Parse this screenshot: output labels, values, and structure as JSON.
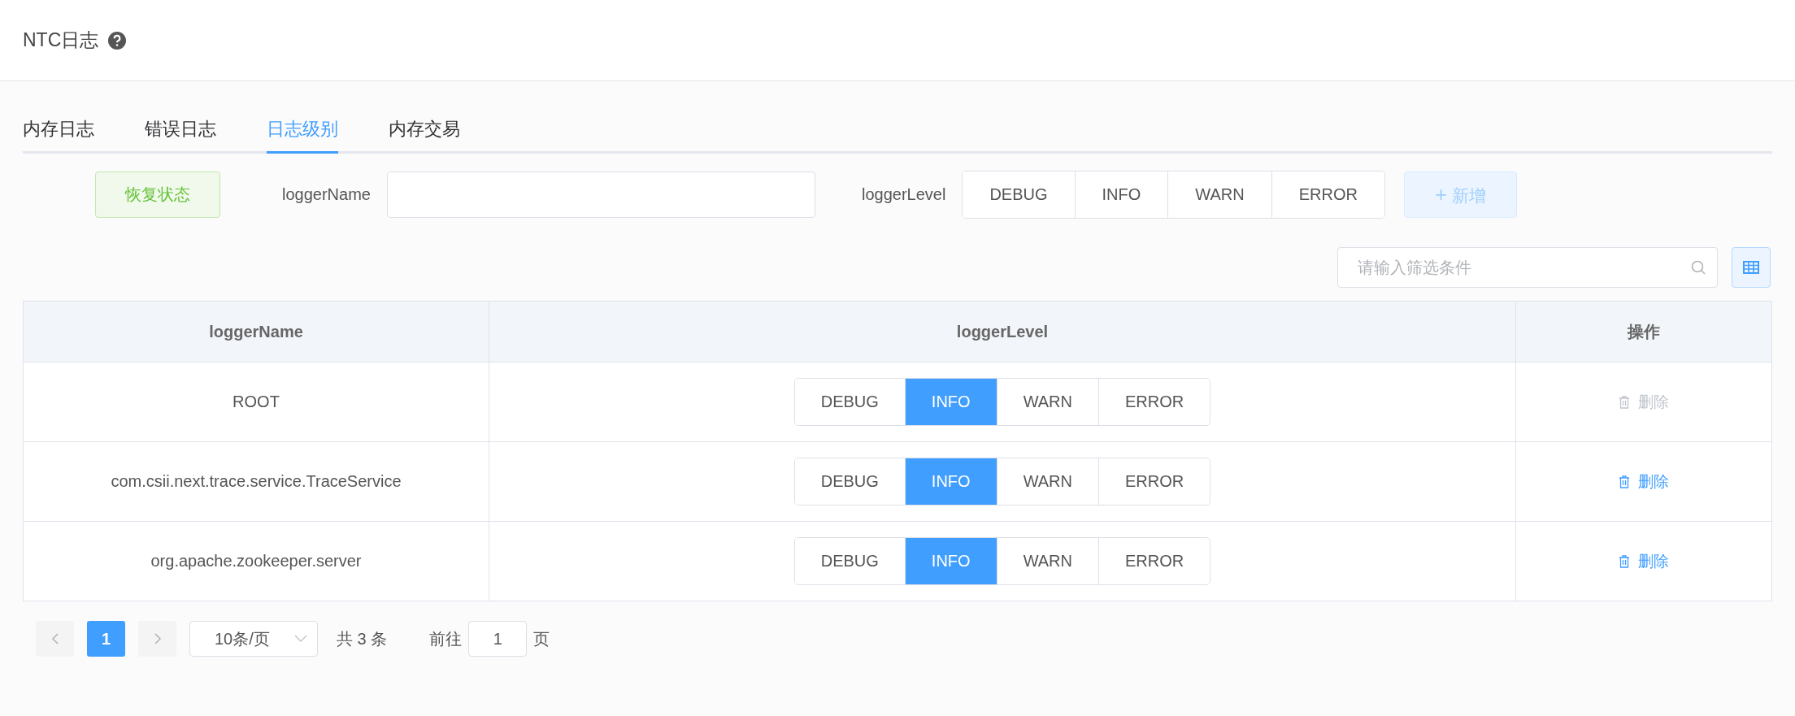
{
  "page": {
    "title": "NTC日志"
  },
  "tabs": [
    {
      "label": "内存日志",
      "selected": false
    },
    {
      "label": "错误日志",
      "selected": false
    },
    {
      "label": "日志级别",
      "selected": true
    },
    {
      "label": "内存交易",
      "selected": false
    }
  ],
  "form": {
    "restore_button": "恢复状态",
    "name_label": "loggerName",
    "level_label": "loggerLevel",
    "levels": [
      {
        "label": "DEBUG",
        "selected": false
      },
      {
        "label": "INFO",
        "selected": false
      },
      {
        "label": "WARN",
        "selected": false
      },
      {
        "label": "ERROR",
        "selected": false
      }
    ],
    "add_button": {
      "icon": "+",
      "label": "新增",
      "disabled": true
    }
  },
  "search": {
    "placeholder": "请输入筛选条件"
  },
  "table": {
    "columns": [
      "loggerName",
      "loggerLevel",
      "操作"
    ],
    "rows": [
      {
        "name": "ROOT",
        "levels": [
          {
            "label": "DEBUG",
            "selected": false
          },
          {
            "label": "INFO",
            "selected": true
          },
          {
            "label": "WARN",
            "selected": false
          },
          {
            "label": "ERROR",
            "selected": false
          }
        ],
        "action": {
          "label": "删除",
          "disabled": true
        }
      },
      {
        "name": "com.csii.next.trace.service.TraceService",
        "levels": [
          {
            "label": "DEBUG",
            "selected": false
          },
          {
            "label": "INFO",
            "selected": true
          },
          {
            "label": "WARN",
            "selected": false
          },
          {
            "label": "ERROR",
            "selected": false
          }
        ],
        "action": {
          "label": "删除",
          "disabled": false
        }
      },
      {
        "name": "org.apache.zookeeper.server",
        "levels": [
          {
            "label": "DEBUG",
            "selected": false
          },
          {
            "label": "INFO",
            "selected": true
          },
          {
            "label": "WARN",
            "selected": false
          },
          {
            "label": "ERROR",
            "selected": false
          }
        ],
        "action": {
          "label": "删除",
          "disabled": false
        }
      }
    ]
  },
  "pagination": {
    "pages": [
      {
        "label": "1",
        "selected": true
      }
    ],
    "page_size": "10条/页",
    "total": "共 3 条",
    "goto_label": "前往",
    "goto_value": "1",
    "goto_suffix": "页"
  }
}
